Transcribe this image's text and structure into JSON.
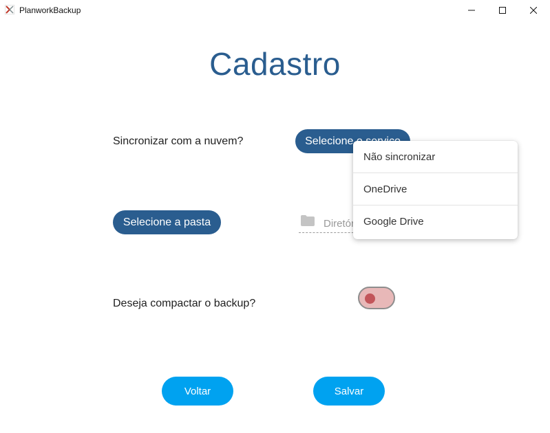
{
  "window": {
    "title": "PlanworkBackup",
    "icons": {
      "app": "planwork-app-icon",
      "minimize": "minimize-icon",
      "maximize": "maximize-icon",
      "close": "close-icon"
    }
  },
  "page": {
    "title": "Cadastro"
  },
  "sync": {
    "question": "Sincronizar com a nuvem?",
    "service_button_label": "Selecione o serviço",
    "dropdown_options": [
      "Não sincronizar",
      "OneDrive",
      "Google Drive"
    ]
  },
  "folder": {
    "button_label": "Selecione a pasta",
    "directory_placeholder": "Diretório",
    "icon": "folder-icon"
  },
  "compact": {
    "question": "Deseja compactar o backup?",
    "enabled": false
  },
  "actions": {
    "back_label": "Voltar",
    "save_label": "Salvar"
  },
  "colors": {
    "title": "#2a5d8f",
    "primary_dark": "#2a5d8f",
    "primary_light": "#00a2f0",
    "toggle_track_off": "#e8b8b8",
    "toggle_knob_off": "#c2555a"
  }
}
